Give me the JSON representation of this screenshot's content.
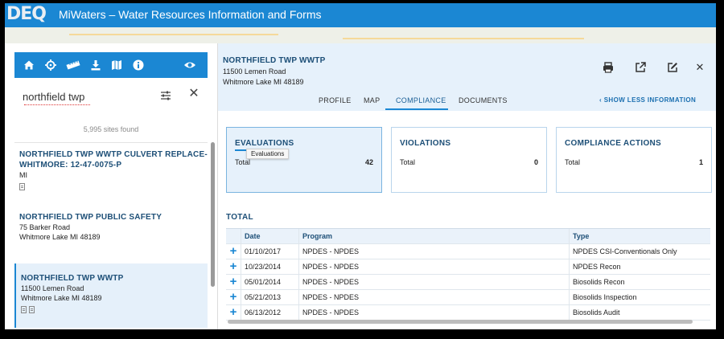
{
  "app": {
    "logo_text": "DEQ",
    "title": "MiWaters – Water Resources Information and Forms"
  },
  "toolbar": {
    "icons": [
      "home-icon",
      "crosshair-icon",
      "ruler-icon",
      "download-icon",
      "map-icon",
      "info-icon",
      "eye-icon"
    ]
  },
  "search": {
    "value": "northfield twp",
    "results_count": "5,995 sites found"
  },
  "sites": [
    {
      "name": "NORTHFIELD TWP WWTP CULVERT REPLACE-WHITMORE: 12-47-0075-P",
      "addr1": "MI",
      "addr2": ""
    },
    {
      "name": "NORTHFIELD TWP PUBLIC SAFETY",
      "addr1": "75 Barker Road",
      "addr2": "Whitmore Lake MI 48189"
    },
    {
      "name": "NORTHFIELD TWP WWTP",
      "addr1": "11500 Lemen Road",
      "addr2": "Whitmore Lake MI 48189"
    }
  ],
  "facility": {
    "name": "NORTHFIELD TWP WWTP",
    "addr1": "11500 Lemen Road",
    "addr2": "Whitmore Lake MI 48189"
  },
  "tabs": [
    {
      "label": "PROFILE"
    },
    {
      "label": "MAP"
    },
    {
      "label": "COMPLIANCE"
    },
    {
      "label": "DOCUMENTS"
    }
  ],
  "show_less": "SHOW LESS INFORMATION",
  "cards": [
    {
      "title": "EVALUATIONS",
      "total_label": "Total",
      "count": "42",
      "tooltip": "Evaluations"
    },
    {
      "title": "VIOLATIONS",
      "total_label": "Total",
      "count": "0"
    },
    {
      "title": "COMPLIANCE ACTIONS",
      "total_label": "Total",
      "count": "1"
    }
  ],
  "total_label": "TOTAL",
  "table": {
    "headers": [
      "Date",
      "Program",
      "Type"
    ],
    "rows": [
      [
        "01/10/2017",
        "NPDES - NPDES",
        "NPDES CSI-Conventionals Only"
      ],
      [
        "10/23/2014",
        "NPDES - NPDES",
        "NPDES Recon"
      ],
      [
        "05/01/2014",
        "NPDES - NPDES",
        "Biosolids Recon"
      ],
      [
        "05/21/2013",
        "NPDES - NPDES",
        "Biosolids Inspection"
      ],
      [
        "06/13/2012",
        "NPDES - NPDES",
        "Biosolids Audit"
      ]
    ]
  },
  "colors": {
    "brand_blue": "#1b87d3",
    "heading_navy": "#1d4f77",
    "panel_light": "#e6f1fb"
  }
}
